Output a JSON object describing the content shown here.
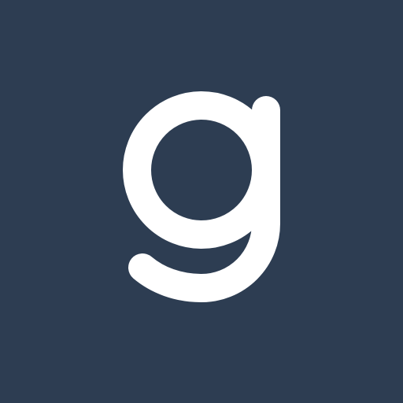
{
  "icon": {
    "name": "g-letter-logo",
    "letter": "g",
    "background_color": "#2d3d52",
    "foreground_color": "#ffffff"
  }
}
